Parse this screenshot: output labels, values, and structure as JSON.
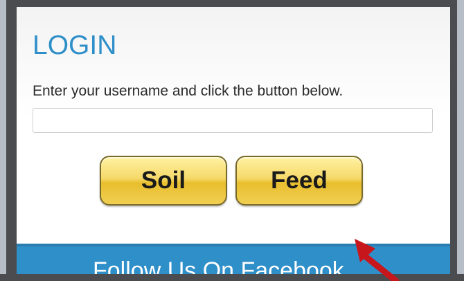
{
  "login": {
    "title": "LOGIN",
    "instructions": "Enter your username and click the button below.",
    "username_value": "",
    "username_placeholder": ""
  },
  "buttons": {
    "soil_label": "Soil",
    "feed_label": "Feed"
  },
  "footer": {
    "text": "Follow Us On Facebook"
  },
  "colors": {
    "accent_blue": "#2f8fc9",
    "button_gold": "#f6d96a",
    "arrow_red": "#c8171c"
  },
  "icons": {
    "annotation": "red-arrow-icon"
  }
}
